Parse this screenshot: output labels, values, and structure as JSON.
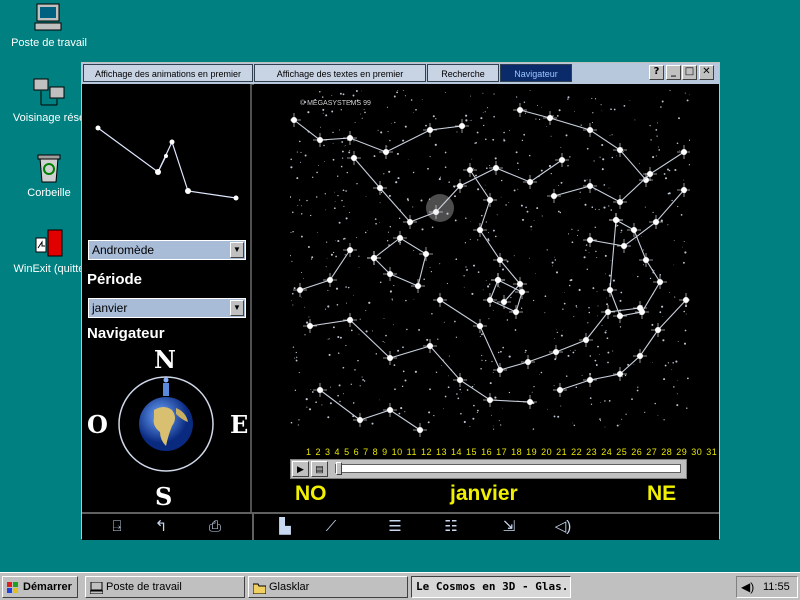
{
  "desktop": {
    "icons": [
      {
        "label": "Poste de travail",
        "icon": "computer-icon"
      },
      {
        "label": "Voisinage rése",
        "icon": "network-icon"
      },
      {
        "label": "Corbeille",
        "icon": "recycle-bin-icon"
      },
      {
        "label": "WinExit (quitte",
        "icon": "winexit-icon"
      }
    ]
  },
  "window": {
    "tabs": [
      {
        "label": "Affichage des animations en premier"
      },
      {
        "label": "Affichage des textes en premier"
      },
      {
        "label": "Recherche"
      },
      {
        "label": "Navigateur",
        "active": true
      }
    ],
    "controls": {
      "help": "?",
      "minimize": "_",
      "maximize": "□",
      "close": "✕"
    }
  },
  "left_panel": {
    "constellation_select": "Andromède",
    "period_heading": "Période",
    "period_select": "janvier",
    "navigator_heading": "Navigateur",
    "compass": {
      "north": "N",
      "south": "S",
      "east": "E",
      "west": "O"
    }
  },
  "sky": {
    "copyright": "© MEGASYSTEMS 99",
    "days": [
      "1",
      "2",
      "3",
      "4",
      "5",
      "6",
      "7",
      "8",
      "9",
      "10",
      "11",
      "12",
      "13",
      "14",
      "15",
      "16",
      "17",
      "18",
      "19",
      "20",
      "21",
      "22",
      "23",
      "24",
      "25",
      "26",
      "27",
      "28",
      "29",
      "30",
      "31"
    ],
    "direction_left": "NO",
    "month": "janvier",
    "direction_right": "NE",
    "slider_position": 0.0
  },
  "toolbar": {
    "left_tools": [
      "exit-door-icon",
      "back-arrow-icon",
      "print-icon"
    ],
    "right_tools": [
      "projector-icon",
      "telescope-icon",
      "notes-icon",
      "help-notes-icon",
      "pointer-icon",
      "speaker-icon"
    ]
  },
  "taskbar": {
    "start_label": "Démarrer",
    "buttons": [
      {
        "label": "Poste de travail",
        "icon": "computer-icon"
      },
      {
        "label": "Glasklar",
        "icon": "folder-icon"
      },
      {
        "label": "Le Cosmos en 3D - Glas...",
        "active": true
      }
    ],
    "clock": "11:55"
  },
  "colors": {
    "desktop": "#008080",
    "accent_yellow": "#f0f000",
    "active_tab": "#0a2a6a"
  }
}
